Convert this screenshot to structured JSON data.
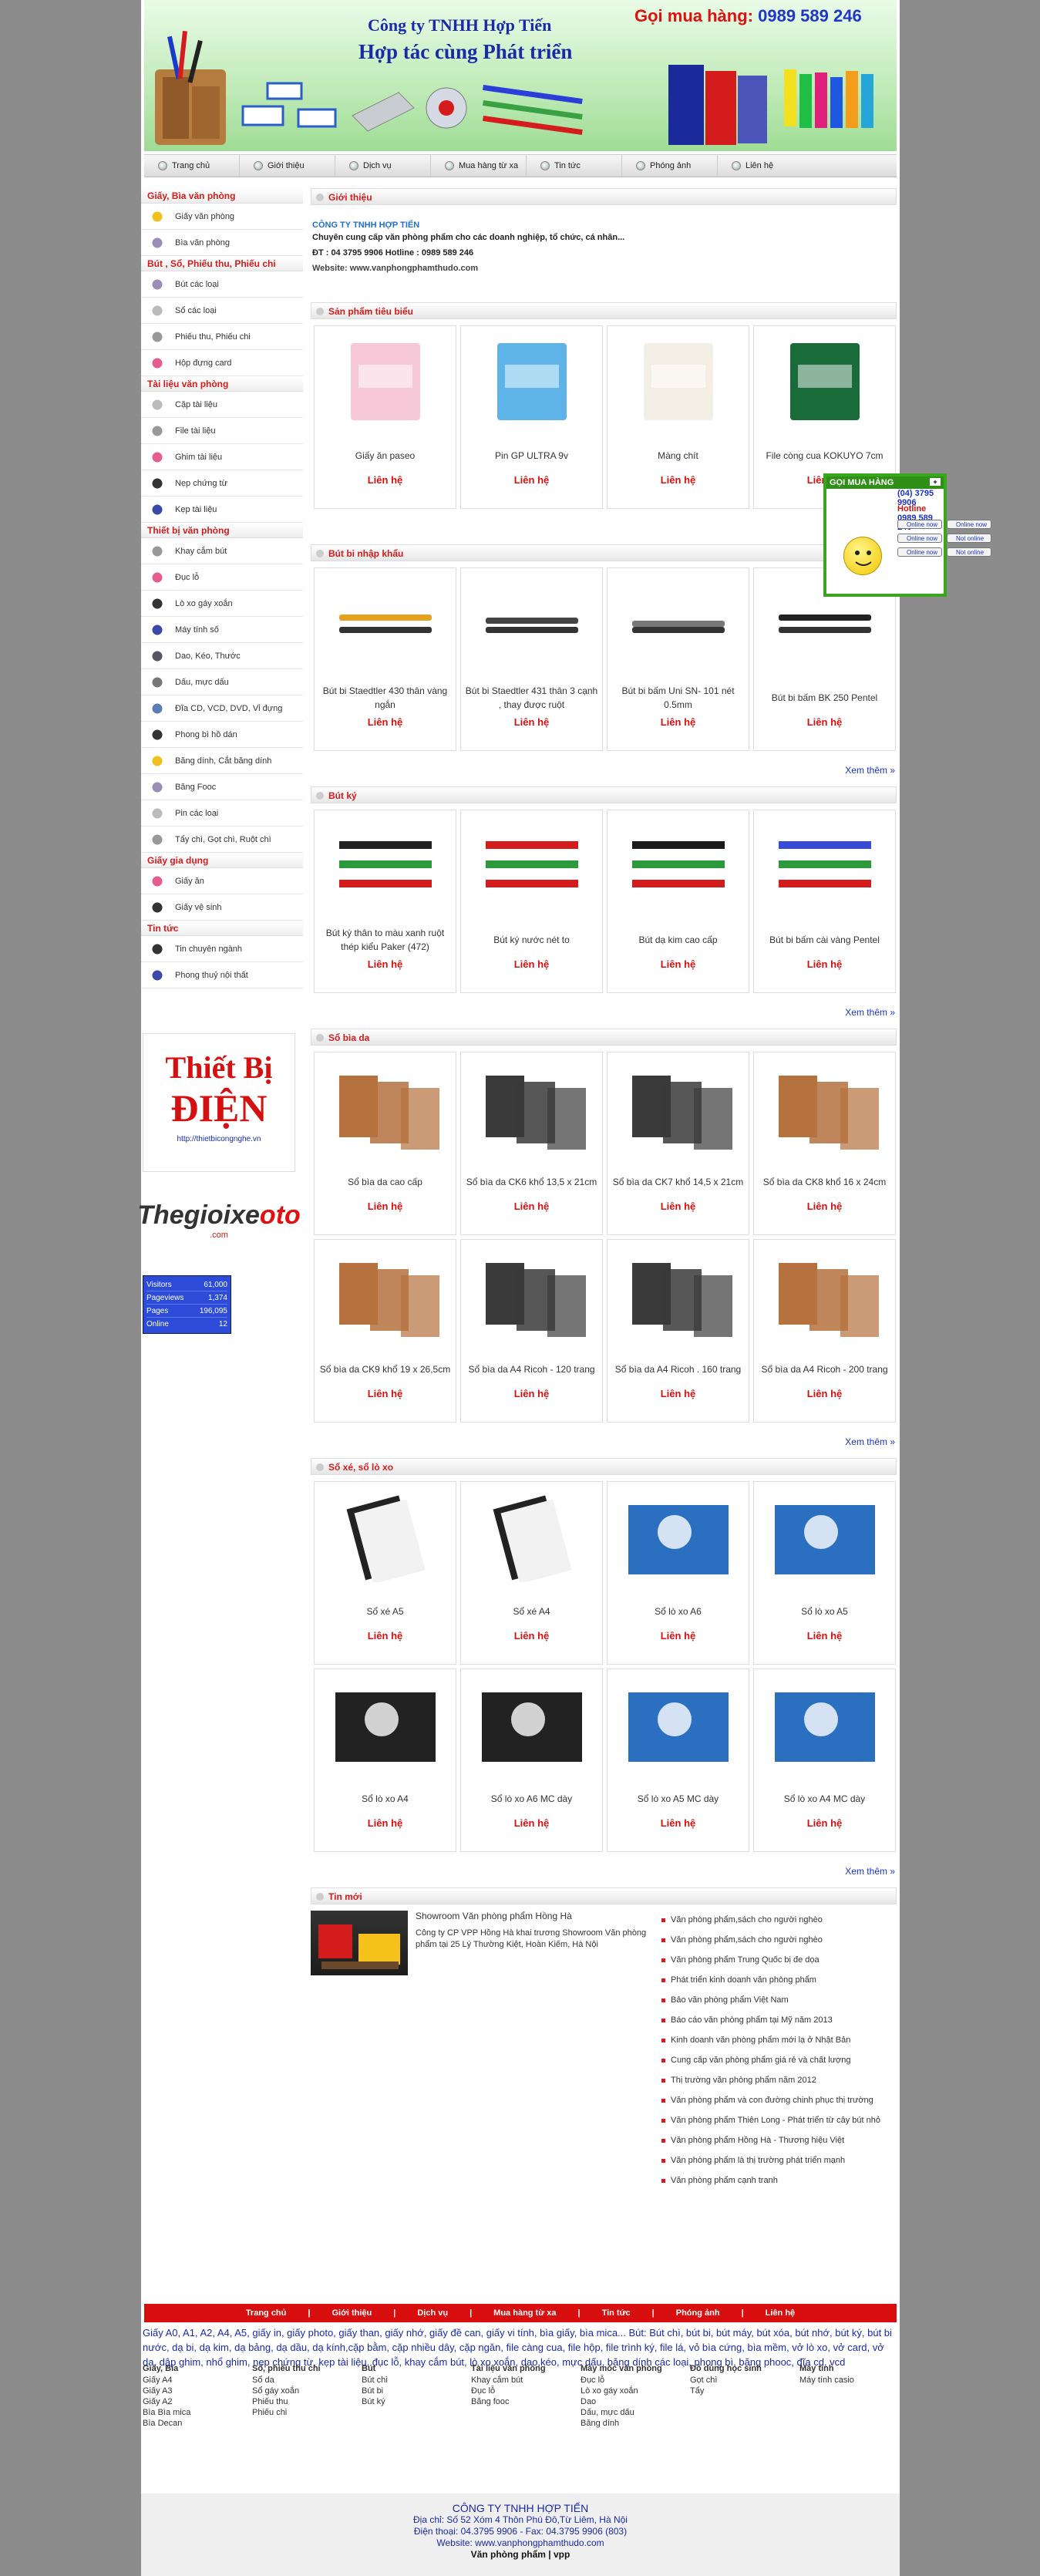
{
  "header": {
    "company": "Công ty TNHH Hợp Tiến",
    "slogan": "Hợp tác cùng Phát triển",
    "hotline_label": "Gọi mua hàng:",
    "hotline_number": "0989 589 246"
  },
  "nav": [
    "Trang chủ",
    "Giới thiệu",
    "Dịch vụ",
    "Mua hàng từ xa",
    "Tin tức",
    "Phóng ảnh",
    "Liên hệ"
  ],
  "sidebar": [
    {
      "title": "Giấy, Bìa văn phòng",
      "items": [
        "Giấy văn phòng",
        "Bìa văn phòng"
      ]
    },
    {
      "title": "Bút , Sổ, Phiếu thu, Phiếu chi",
      "items": [
        "Bút các loại",
        "Sổ các loại",
        "Phiếu thu, Phiếu chi",
        "Hộp đựng card"
      ]
    },
    {
      "title": "Tài liệu văn phòng",
      "items": [
        "Cặp tài liệu",
        "File tài liệu",
        "Ghim tài liệu",
        "Nẹp chứng từ",
        "Kẹp tài liệu"
      ]
    },
    {
      "title": "Thiết bị văn phòng",
      "items": [
        "Khay cắm bút",
        "Đục lỗ",
        "Lò xo gáy xoắn",
        "Máy tính số",
        "Dao, Kéo, Thước",
        "Dấu, mực dấu",
        "Đĩa CD, VCD, DVD, Vỉ đựng",
        "Phong bì hồ dán",
        "Băng dính, Cắt băng dính",
        "Băng Fooc",
        "Pin các loại",
        "Tẩy chì, Gọt chì, Ruột chì"
      ]
    },
    {
      "title": "Giấy gia dụng",
      "items": [
        "Giấy ăn",
        "Giấy vệ sinh"
      ]
    },
    {
      "title": "Tin tức",
      "items": [
        "Tin chuyên ngành",
        "Phong thuỷ nội thất"
      ]
    }
  ],
  "ads": {
    "ad1_line1": "Thiết Bị",
    "ad1_line2": "ĐIỆN",
    "ad1_url": "http://thietbicongnghe.vn",
    "ad2_part1": "Thegioixe",
    "ad2_part2": "oto",
    "ad2_domain": ".com"
  },
  "counter": [
    {
      "label": "Visitors",
      "value": "61,000"
    },
    {
      "label": "Pageviews",
      "value": "1,374"
    },
    {
      "label": "Pages",
      "value": "196,095"
    },
    {
      "label": "Online",
      "value": "12"
    }
  ],
  "intro": {
    "title": "Giới thiệu",
    "company": "CÔNG TY TNHH HỢP TIẾN",
    "desc": "Chuyên cung cấp văn phòng phẩm cho các doanh nghiệp, tổ chức, cá nhân...",
    "phone": "ĐT : 04 3795 9906      Hotline : 0989 589 246",
    "website": "Website: www.vanphongphamthudo.com"
  },
  "sections": [
    {
      "title": "Sản phẩm tiêu biểu",
      "more": "",
      "products": [
        {
          "name": "Giấy ăn paseo",
          "price": "Liên hệ"
        },
        {
          "name": "Pin GP ULTRA 9v",
          "price": "Liên hệ"
        },
        {
          "name": "Màng chít",
          "price": "Liên hệ"
        },
        {
          "name": "File còng cua KOKUYO 7cm",
          "price": "Liên hệ"
        }
      ]
    },
    {
      "title": "Bút bi nhập khẩu",
      "more": "Xem thêm »",
      "products": [
        {
          "name": "Bút bi Staedtler 430 thân vàng ngắn",
          "price": "Liên hệ"
        },
        {
          "name": "Bút bi Staedtler 431 thân 3 cạnh , thay được ruột",
          "price": "Liên hệ"
        },
        {
          "name": "Bút bi bấm Uni SN- 101 nét 0.5mm",
          "price": "Liên hệ"
        },
        {
          "name": "Bút bi bấm BK 250 Pentel",
          "price": "Liên hệ"
        }
      ]
    },
    {
      "title": "Bút ký",
      "more": "Xem thêm »",
      "products": [
        {
          "name": "Bút ký thân to màu xanh ruột thép kiểu Paker (472)",
          "price": "Liên hệ"
        },
        {
          "name": "Bút ký nước nét to",
          "price": "Liên hệ"
        },
        {
          "name": "Bút dạ kim cao cấp",
          "price": "Liên hệ"
        },
        {
          "name": "Bút bi bấm cài vàng Pentel",
          "price": "Liên hệ"
        }
      ]
    },
    {
      "title": "Sổ bìa da",
      "more": "Xem thêm »",
      "products": [
        {
          "name": "Sổ bìa da cao cấp",
          "price": "Liên hệ"
        },
        {
          "name": "Sổ bìa da CK6 khổ 13,5 x 21cm",
          "price": "Liên hệ"
        },
        {
          "name": "Sổ bìa da CK7 khổ 14,5 x 21cm",
          "price": "Liên hệ"
        },
        {
          "name": "Sổ bìa da CK8 khổ 16 x 24cm",
          "price": "Liên hệ"
        },
        {
          "name": "Sổ bìa da CK9 khổ 19 x 26,5cm",
          "price": "Liên hệ"
        },
        {
          "name": "Sổ bìa da A4 Ricoh - 120 trang",
          "price": "Liên hệ"
        },
        {
          "name": "Sổ bìa da A4 Ricoh . 160 trang",
          "price": "Liên hệ"
        },
        {
          "name": "Sổ bìa da A4 Ricoh - 200 trang",
          "price": "Liên hệ"
        }
      ]
    },
    {
      "title": "Sổ xé, sổ lò xo",
      "more": "Xem thêm »",
      "products": [
        {
          "name": "Sổ xé A5",
          "price": "Liên hệ"
        },
        {
          "name": "Sổ xé A4",
          "price": "Liên hệ"
        },
        {
          "name": "Sổ lò xo A6",
          "price": "Liên hệ"
        },
        {
          "name": "Sổ lò xo A5",
          "price": "Liên hệ"
        },
        {
          "name": "Sổ lò xo A4",
          "price": "Liên hệ"
        },
        {
          "name": "Sổ lò xo A6 MC dày",
          "price": "Liên hệ"
        },
        {
          "name": "Sổ lò xo A5 MC dày",
          "price": "Liên hệ"
        },
        {
          "name": "Sổ lò xo A4 MC dày",
          "price": "Liên hệ"
        }
      ]
    }
  ],
  "news": {
    "title": "Tin mới",
    "featured_title": "Showroom Văn phòng phẩm Hồng Hà",
    "featured_desc": "Công ty CP VPP Hồng Hà khai trương Showroom Văn phòng phẩm tại 25 Lý Thường Kiệt, Hoàn Kiếm, Hà Nội",
    "items": [
      "Văn phòng phẩm,sách cho người nghèo",
      "Văn phòng phẩm,sách cho người nghèo",
      "Văn phòng phẩm Trung Quốc bị đe dọa",
      "Phát triển kinh doanh văn phòng phẩm",
      "Bảo văn phòng phẩm Việt Nam",
      "Báo cáo văn phòng phẩm tại Mỹ năm 2013",
      "Kinh doanh văn phòng phẩm mới lạ ở Nhật Bản",
      "Cung cấp văn phòng phẩm giá rẻ và chất lượng",
      "Thị trường văn phòng phẩm năm 2012",
      "Văn phòng phẩm và con đường chinh phục thị trường",
      "Văn phòng phẩm Thiên Long - Phát triển từ cây bút nhỏ",
      "Văn phòng phẩm Hồng Hà - Thương hiệu Việt",
      "Văn phòng phẩm là thị trường phát triển mạnh",
      "Văn phòng phẩm cạnh tranh"
    ]
  },
  "support": {
    "title": "GỌI MUA HÀNG",
    "phone": "(04) 3795 9906",
    "hotline_label": "Hotline",
    "hotline": "0989 589 246",
    "badge_online": "Online now",
    "badge_offline": "Not online"
  },
  "footer_nav": [
    "Trang chủ",
    "Giới thiệu",
    "Dịch vụ",
    "Mua hàng từ xa",
    "Tin tức",
    "Phóng ảnh",
    "Liên hệ"
  ],
  "keywords": "Giấy A0, A1, A2, A4, A5, giấy in, giấy photo, giấy than, giấy nhớ, giấy đề can, giấy vi tính, bìa giấy, bìa mica... Bút: Bút chì, bút bi, bút máy, bút xóa, bút nhớ, bút ký, bút bi nước, dạ bi, dạ kim, dạ bảng, dạ dầu, dạ kính,cặp bằm, cặp nhiều dây, cặp ngăn, file càng cua, file hộp, file trình ký, file lá, vỏ bìa cứng, bìa mềm, vở lò xo, vở card, vở da, dập ghim, nhổ ghim, nẹp chứng từ, kẹp tài liệu, đục lỗ, khay cắm bút, lò xo xoắn, dao,kéo, mực dấu, băng dính các loại, phong bì, băng phooc, đĩa cd, vcd",
  "footer_cols": [
    {
      "title": "Giấy, Bìa",
      "items": [
        "Giấy A4",
        "Giấy A3",
        "Giấy A2",
        "Bìa Bìa mica",
        "Bìa Decan"
      ]
    },
    {
      "title": "Sổ, phiếu thu chi",
      "items": [
        "Sổ da",
        "Sổ gáy xoắn",
        "Phiếu thu",
        "Phiếu chi"
      ]
    },
    {
      "title": "Bút",
      "items": [
        "Bút chì",
        "Bút bi",
        "Bút ký"
      ]
    },
    {
      "title": "Tài liệu văn phòng",
      "items": [
        "Khay cắm bút",
        "Đục lỗ",
        "Băng fooc"
      ]
    },
    {
      "title": "Máy móc văn phòng",
      "items": [
        "Đục lỗ",
        "Lò xo gáy xoắn",
        "Dao",
        "Dấu, mực dấu",
        "Băng dính"
      ]
    },
    {
      "title": "Đồ dùng học sinh",
      "items": [
        "Gọt chì",
        "Tẩy"
      ]
    },
    {
      "title": "Máy tính",
      "items": [
        "Máy tính casio"
      ]
    }
  ],
  "footer": {
    "company": "CÔNG TY TNHH HỢP TIẾN",
    "address": "Địa chỉ: Số 52 Xóm 4 Thôn Phú Đô,Từ Liêm, Hà Nội",
    "phone": "Điện thoại: 04.3795 9906 - Fax: 04.3795 9906 (803)",
    "website": "Website: www.vanphongphamthudo.com",
    "tag": "Văn phòng phẩm | vpp"
  },
  "colors": {
    "brand_red": "#d41c1c",
    "link_blue": "#1a33c8",
    "banner_green": "#b7e7ae"
  }
}
